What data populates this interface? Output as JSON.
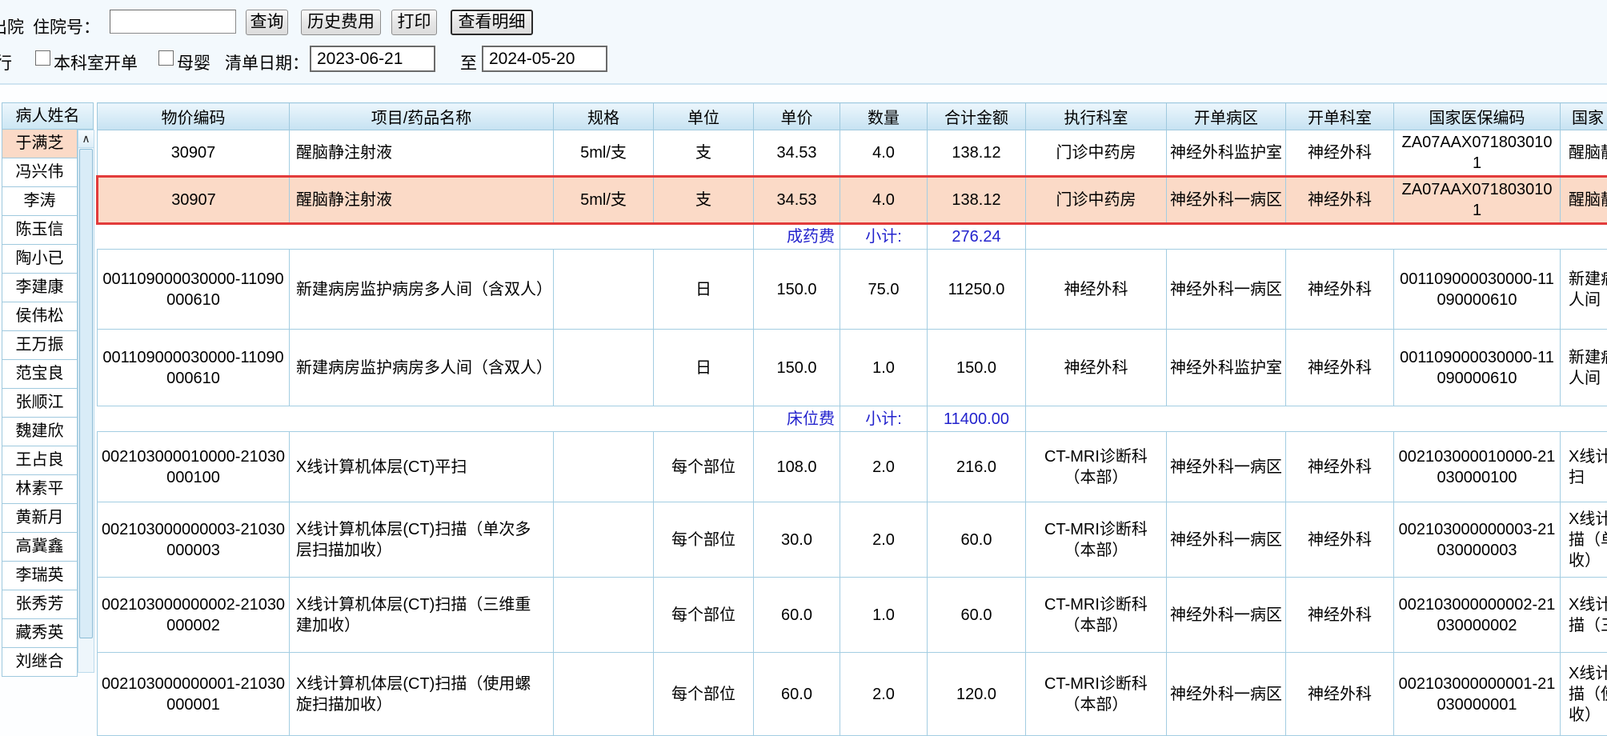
{
  "toolbar": {
    "discharge_label": "出院",
    "admission_no_label": "住院号：",
    "admission_no_value": "",
    "query_button": "查询",
    "history_button": "历史费用",
    "print_button": "打印",
    "detail_button": "查看明细"
  },
  "filters": {
    "clipped_label": "行",
    "own_dept_label": "本科室开单",
    "maternal_label": "母婴",
    "date_label": "清单日期：",
    "date_from": "2023-06-21",
    "to_label": "至",
    "date_to": "2024-05-20"
  },
  "sidebar": {
    "header": "病人姓名",
    "selected_index": 0,
    "patients": [
      "于满芝",
      "冯兴伟",
      "李涛",
      "陈玉信",
      "陶小已",
      "李建康",
      "侯伟松",
      "王万振",
      "范宝良",
      "张顺江",
      "魏建欣",
      "王占良",
      "林素平",
      "黄新月",
      "高冀鑫",
      "李瑞英",
      "张秀芳",
      "藏秀英",
      "刘继合"
    ],
    "scroll_up_glyph": "∧"
  },
  "table": {
    "columns": [
      "物价编码",
      "项目/药品名称",
      "规格",
      "单位",
      "单价",
      "数量",
      "合计金额",
      "执行科室",
      "开单病区",
      "开单科室",
      "国家医保编码",
      "国家"
    ],
    "rows": [
      {
        "type": "item",
        "code": "30907",
        "name": "醒脑静注射液",
        "spec": "5ml/支",
        "unit": "支",
        "price": "34.53",
        "qty": "4.0",
        "total": "138.12",
        "exec": "门诊中药房",
        "ward": "神经外科监护室",
        "dept": "神经外科",
        "insurance_code": "ZA07AAX0718030101",
        "insurance_name": "醒脑静注射液"
      },
      {
        "type": "item",
        "selected": true,
        "code": "30907",
        "name": "醒脑静注射液",
        "spec": "5ml/支",
        "unit": "支",
        "price": "34.53",
        "qty": "4.0",
        "total": "138.12",
        "exec": "门诊中药房",
        "ward": "神经外科一病区",
        "dept": "神经外科",
        "insurance_code": "ZA07AAX0718030101",
        "insurance_name": "醒脑静注射液"
      },
      {
        "type": "subtotal",
        "category": "成药费",
        "label": "小计:",
        "amount": "276.24"
      },
      {
        "type": "item",
        "code": "001109000030000-11090000610",
        "name": "新建病房监护病房多人间（含双人）",
        "spec": "",
        "unit": "日",
        "price": "150.0",
        "qty": "75.0",
        "total": "11250.0",
        "exec": "神经外科",
        "ward": "神经外科一病区",
        "dept": "神经外科",
        "insurance_code": "001109000030000-11090000610",
        "insurance_name": "新建病房监护病房多人间（含双人）"
      },
      {
        "type": "item",
        "code": "001109000030000-11090000610",
        "name": "新建病房监护病房多人间（含双人）",
        "spec": "",
        "unit": "日",
        "price": "150.0",
        "qty": "1.0",
        "total": "150.0",
        "exec": "神经外科",
        "ward": "神经外科监护室",
        "dept": "神经外科",
        "insurance_code": "001109000030000-11090000610",
        "insurance_name": "新建病房监护病房多人间（含双人）"
      },
      {
        "type": "subtotal",
        "category": "床位费",
        "label": "小计:",
        "amount": "11400.00"
      },
      {
        "type": "item",
        "code": "002103000010000-21030000100",
        "name": "X线计算机体层(CT)平扫",
        "spec": "",
        "unit": "每个部位",
        "price": "108.0",
        "qty": "2.0",
        "total": "216.0",
        "exec": "CT-MRI诊断科（本部）",
        "ward": "神经外科一病区",
        "dept": "神经外科",
        "insurance_code": "002103000010000-21030000100",
        "insurance_name": "X线计算机体层(CT)平扫"
      },
      {
        "type": "item",
        "code": "002103000000003-21030000003",
        "name": "X线计算机体层(CT)扫描（单次多层扫描加收）",
        "spec": "",
        "unit": "每个部位",
        "price": "30.0",
        "qty": "2.0",
        "total": "60.0",
        "exec": "CT-MRI诊断科（本部）",
        "ward": "神经外科一病区",
        "dept": "神经外科",
        "insurance_code": "002103000000003-21030000003",
        "insurance_name": "X线计算机体层(CT)扫描（单次多层扫描加收）"
      },
      {
        "type": "item",
        "code": "002103000000002-21030000002",
        "name": "X线计算机体层(CT)扫描（三维重建加收）",
        "spec": "",
        "unit": "每个部位",
        "price": "60.0",
        "qty": "1.0",
        "total": "60.0",
        "exec": "CT-MRI诊断科（本部）",
        "ward": "神经外科一病区",
        "dept": "神经外科",
        "insurance_code": "002103000000002-21030000002",
        "insurance_name": "X线计算机体层(CT)扫描（三维重建加收）"
      },
      {
        "type": "item",
        "code": "002103000000001-21030000001",
        "name": "X线计算机体层(CT)扫描（使用螺旋扫描加收）",
        "spec": "",
        "unit": "每个部位",
        "price": "60.0",
        "qty": "2.0",
        "total": "120.0",
        "exec": "CT-MRI诊断科（本部）",
        "ward": "神经外科一病区",
        "dept": "神经外科",
        "insurance_code": "002103000000001-21030000001",
        "insurance_name": "X线计算机体层(CT)扫描（使用螺旋扫描加收）"
      }
    ]
  },
  "colors": {
    "subtotal_text": "#2323cd",
    "selected_row_bg": "#fbdac7",
    "selected_row_border": "#e23b3b",
    "grid_line": "#a3cde2",
    "header_gradient_top": "#ecf6fc",
    "header_gradient_bottom": "#c6e2f2"
  }
}
